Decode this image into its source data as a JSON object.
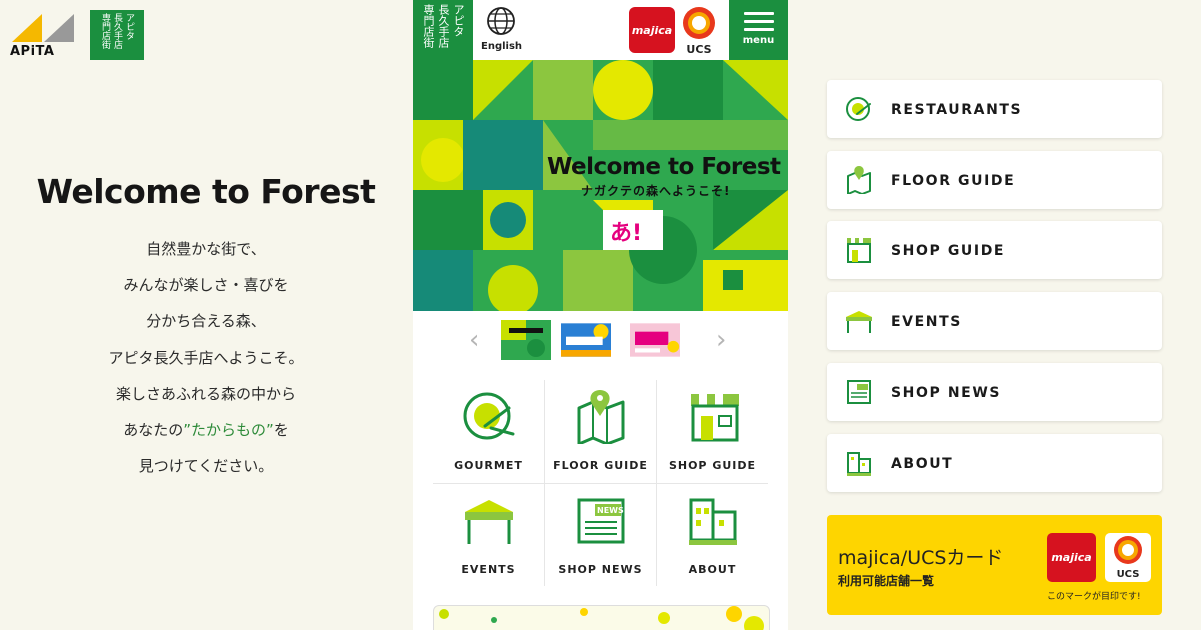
{
  "brand": {
    "apita": "APiTA",
    "shop_logo_cols": [
      "アピタ",
      "長久手店",
      "専門店街"
    ]
  },
  "left": {
    "title": "Welcome to Forest",
    "lines": [
      "自然豊かな街で、",
      "みんなが楽しさ・喜びを",
      "分かち合える森、",
      "アピタ長久手店へようこそ。",
      "楽しさあふれる森の中から"
    ],
    "line6_prefix": "あなたの",
    "line6_highlight": "”たからもの”",
    "line6_suffix": "を",
    "line7": "見つけてください。"
  },
  "phone": {
    "english_label": "English",
    "majica_label": "majica",
    "ucs_label": "UCS",
    "menu_label": "menu",
    "hero_title": "Welcome to Forest",
    "hero_sub": "ナガクテの森へようこそ!",
    "hero_sign": "あ!",
    "nav": [
      {
        "label": "GOURMET"
      },
      {
        "label": "FLOOR GUIDE"
      },
      {
        "label": "SHOP GUIDE"
      },
      {
        "label": "EVENTS"
      },
      {
        "label": "SHOP NEWS"
      },
      {
        "label": "ABOUT"
      }
    ],
    "news_badge": "NEWS"
  },
  "right": {
    "items": [
      {
        "label": "RESTAURANTS",
        "icon": "restaurant-icon"
      },
      {
        "label": "FLOOR GUIDE",
        "icon": "map-pin-icon"
      },
      {
        "label": "SHOP GUIDE",
        "icon": "shop-icon"
      },
      {
        "label": "EVENTS",
        "icon": "tent-icon"
      },
      {
        "label": "SHOP NEWS",
        "icon": "newspaper-icon"
      },
      {
        "label": "ABOUT",
        "icon": "building-icon"
      }
    ],
    "card": {
      "title": "majica/UCSカード",
      "subtitle": "利用可能店舗一覧",
      "majica": "majica",
      "ucs": "UCS",
      "note": "このマークが目印です!"
    }
  },
  "colors": {
    "green": "#1b8f3f",
    "lime": "#8cc63f",
    "yellow": "#fed500",
    "red": "#d6121f",
    "background": "#f7f6ec"
  }
}
